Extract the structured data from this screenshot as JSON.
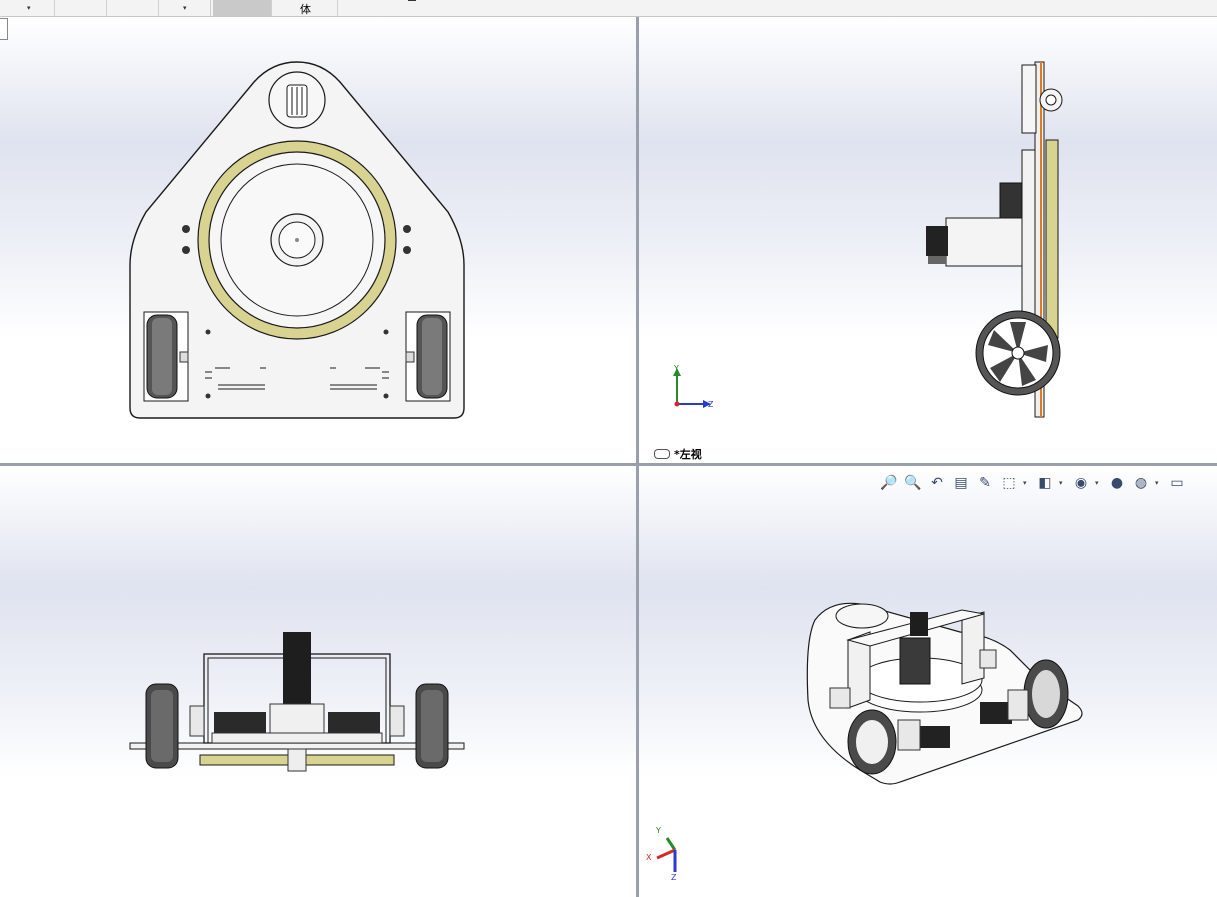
{
  "toolbar": {
    "items": [
      {
        "name": "dropdown-1",
        "arrow": "▾"
      },
      {
        "name": "dropdown-2",
        "arrow": "▾"
      },
      {
        "name": "active-button"
      },
      {
        "name": "body-button",
        "label": "体"
      }
    ]
  },
  "viewports": {
    "top_left": {
      "name": "top-view"
    },
    "top_right": {
      "name": "left-view",
      "label": "*左视",
      "axes": {
        "y": "Y",
        "z": "Z"
      }
    },
    "bottom_left": {
      "name": "front-view"
    },
    "bottom_right": {
      "name": "isometric-view",
      "axes": {
        "x": "X",
        "y": "Y",
        "z": "Z"
      }
    }
  },
  "heads_up_toolbar": {
    "icons": [
      "zoom-to-fit-icon",
      "zoom-to-area-icon",
      "previous-view-icon",
      "section-view-icon",
      "dynamic-annotation-icon",
      "view-orientation-icon",
      "display-style-icon",
      "hide-show-icon",
      "edit-appearance-icon",
      "apply-scene-icon",
      "view-settings-icon"
    ]
  },
  "colors": {
    "model_line": "#1a1a1a",
    "model_fill": "#f2f2f2",
    "ring_gold": "#d4cf8a",
    "axis_y": "#2a8a2a",
    "axis_z": "#2a3ad0",
    "axis_x": "#d02a2a"
  }
}
